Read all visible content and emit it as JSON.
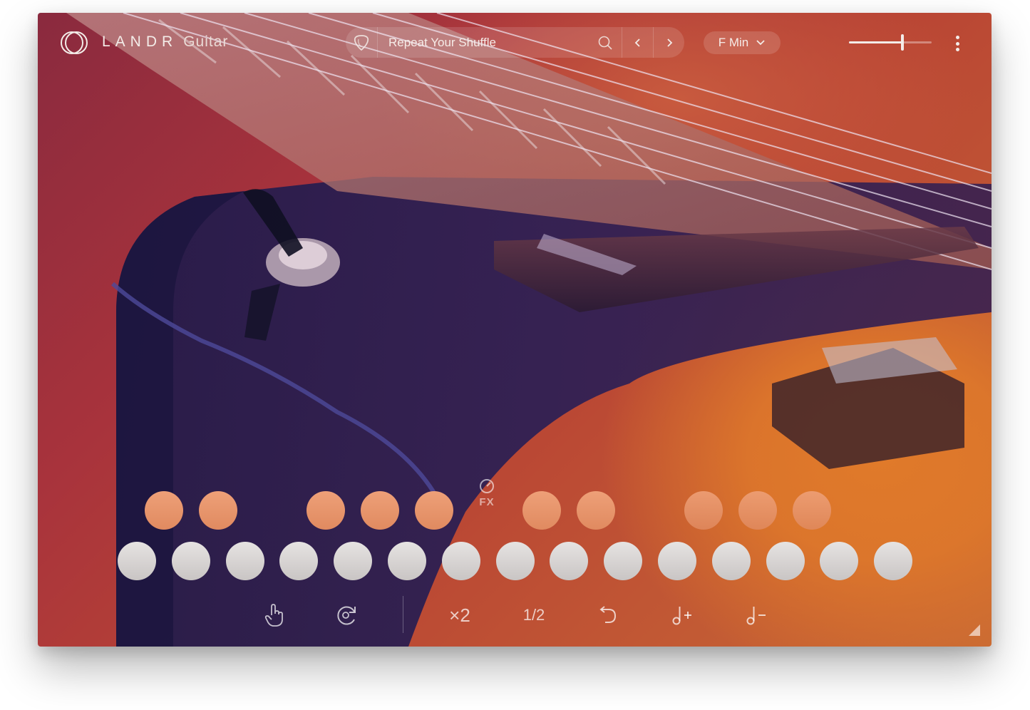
{
  "app": {
    "wordmark": "LANDR",
    "product": "Guitar"
  },
  "preset": {
    "name": "Repeat Your Shuffle",
    "icons": {
      "pick": "guitar-pick-icon",
      "search": "search-icon",
      "prev": "chevron-left-icon",
      "next": "chevron-right-icon"
    }
  },
  "key": {
    "value": "F Min",
    "icon": "chevron-down-icon"
  },
  "volume": {
    "level": 0.65
  },
  "menu": {
    "icon": "more-vertical-icon"
  },
  "pads": {
    "top_row_count": 10,
    "bottom_row_count": 15,
    "accent_color": "#e8946a",
    "bottom_color": "#d9d6d5"
  },
  "fx": {
    "label": "FX",
    "icon": "knob-icon"
  },
  "toolbar": {
    "touch_icon": "tap-hand-icon",
    "loop_icon": "reload-icon",
    "double_label": "×2",
    "half_label": "1/2",
    "undo_icon": "undo-icon",
    "note_plus_icon": "note-plus-icon",
    "note_minus_icon": "note-minus-icon"
  }
}
